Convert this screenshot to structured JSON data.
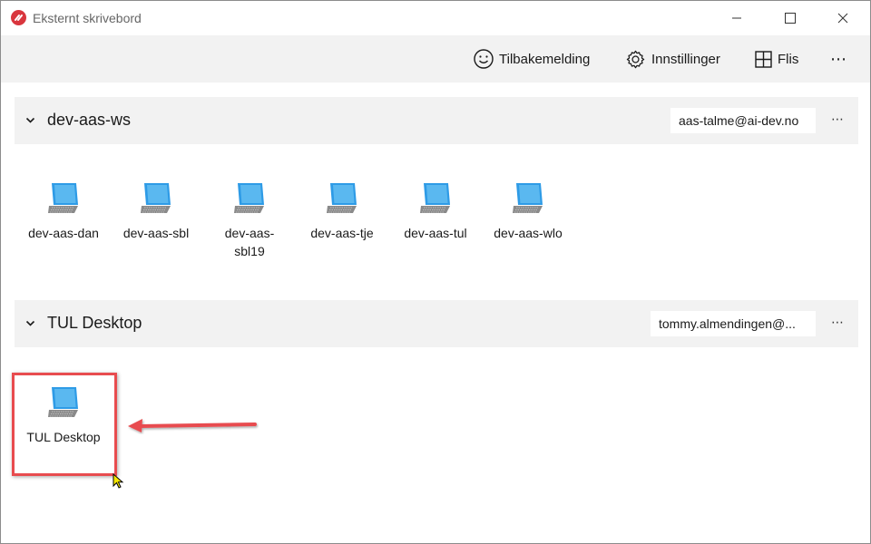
{
  "window": {
    "title": "Eksternt skrivebord",
    "controls": [
      "minimize",
      "maximize",
      "close"
    ]
  },
  "commandbar": {
    "feedback_label": "Tilbakemelding",
    "settings_label": "Innstillinger",
    "tiles_label": "Flis",
    "more_label": "⋯"
  },
  "groups": [
    {
      "name": "dev-aas-ws",
      "account": "aas-talme@ai-dev.no",
      "more_label": "⋯",
      "desktops": [
        {
          "label": "dev-aas-dan"
        },
        {
          "label": "dev-aas-sbl"
        },
        {
          "label": "dev-aas-sbl19"
        },
        {
          "label": "dev-aas-tje"
        },
        {
          "label": "dev-aas-tul"
        },
        {
          "label": "dev-aas-wlo"
        }
      ]
    },
    {
      "name": "TUL Desktop",
      "account": "tommy.almendingen@...",
      "more_label": "⋯",
      "desktops": [
        {
          "label": "TUL Desktop"
        }
      ]
    }
  ],
  "annotation": {
    "highlight_color": "#e84c4f"
  },
  "colors": {
    "accent": "#e84c4f",
    "bar_background": "#f2f2f2",
    "monitor_blue": "#2e9be6"
  }
}
